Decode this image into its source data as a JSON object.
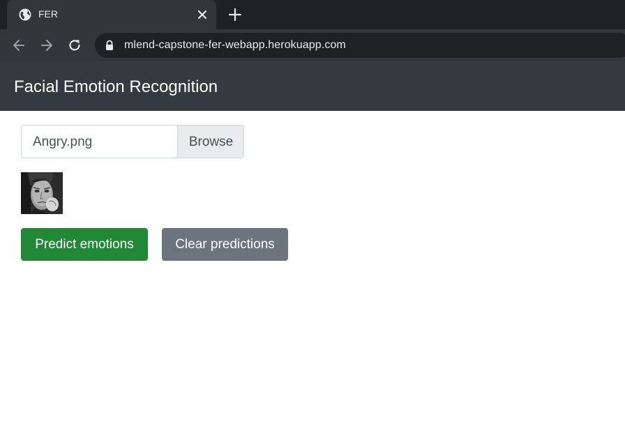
{
  "browser": {
    "tab_title": "FER",
    "url": "mlend-capstone-fer-webapp.herokuapp.com",
    "icons": {
      "favicon": "globe-icon",
      "close": "close-icon",
      "new_tab": "plus-icon",
      "back": "arrow-left-icon",
      "forward": "arrow-right-icon",
      "reload": "reload-icon",
      "secure": "lock-icon"
    }
  },
  "navbar": {
    "brand": "Facial Emotion Recognition",
    "background": "#343a40"
  },
  "upload": {
    "file_name": "Angry.png",
    "browse_label": "Browse"
  },
  "preview": {
    "description_icon": "face-photo"
  },
  "actions": {
    "predict_label": "Predict emotions",
    "clear_label": "Clear predictions",
    "predict_color": "#218838",
    "clear_color": "#6c757d"
  }
}
